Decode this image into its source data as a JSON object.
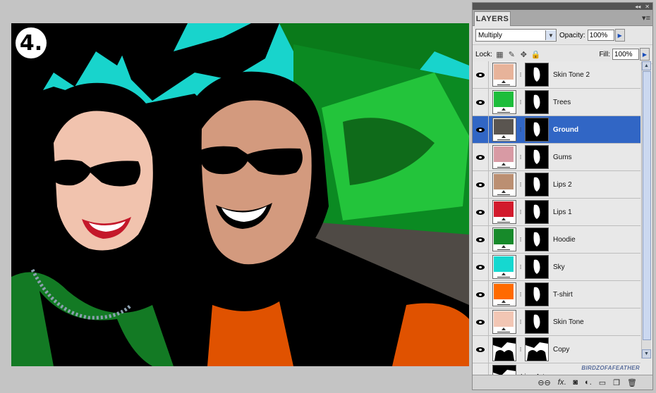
{
  "canvas": {
    "step_label": "4."
  },
  "panel": {
    "tab_title": "LAYERS",
    "blend_mode": "Multiply",
    "opacity_label": "Opacity:",
    "opacity_value": "100%",
    "lock_label": "Lock:",
    "fill_label": "Fill:",
    "fill_value": "100%",
    "watermark": "BIRDZOFAFEATHER",
    "layers": [
      {
        "name": "Skin Tone 2",
        "color": "#e7b39a",
        "selected": false
      },
      {
        "name": "Trees",
        "color": "#1dbd3b",
        "selected": false
      },
      {
        "name": "Ground",
        "color": "#5a5550",
        "selected": true
      },
      {
        "name": "Gums",
        "color": "#d89aa4",
        "selected": false
      },
      {
        "name": "Lips 2",
        "color": "#bb8f72",
        "selected": false
      },
      {
        "name": "Lips 1",
        "color": "#d21a2c",
        "selected": false
      },
      {
        "name": "Hoodie",
        "color": "#178a2a",
        "selected": false
      },
      {
        "name": "Sky",
        "color": "#15d8d0",
        "selected": false
      },
      {
        "name": "T-shirt",
        "color": "#ff6a00",
        "selected": false
      },
      {
        "name": "Skin Tone",
        "color": "#f2c6b4",
        "selected": false
      },
      {
        "name": "Copy",
        "color": null,
        "selected": false
      },
      {
        "name": "Line Art",
        "color": null,
        "selected": false
      }
    ]
  },
  "bottom_icons": [
    "link-icon",
    "fx-icon",
    "mask-icon",
    "adjustment-icon",
    "folder-icon",
    "new-layer-icon",
    "trash-icon"
  ]
}
